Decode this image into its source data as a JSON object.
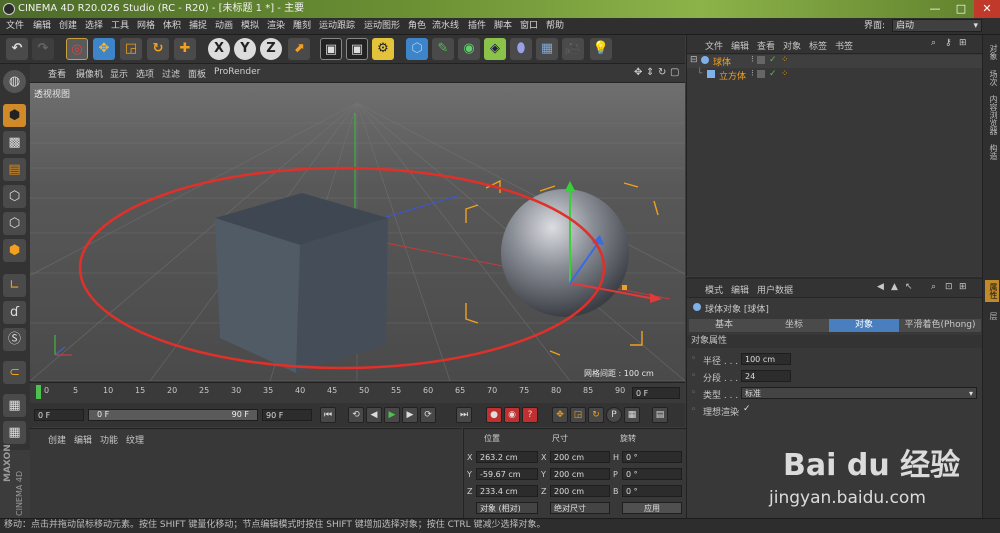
{
  "window": {
    "title": "CINEMA 4D R20.026 Studio (RC - R20) - [未标题 1 *] - 主要",
    "minimize": "—",
    "maximize": "□",
    "close": "✕"
  },
  "menu": {
    "items": [
      "文件",
      "编辑",
      "创建",
      "选择",
      "工具",
      "网格",
      "体积",
      "捕捉",
      "动画",
      "模拟",
      "渲染",
      "雕刻",
      "运动跟踪",
      "运动图形",
      "角色",
      "流水线",
      "插件",
      "脚本",
      "窗口",
      "帮助"
    ],
    "layout_label": "界面:",
    "layout_value": "启动"
  },
  "toolbar": {
    "axis_x": "X",
    "axis_y": "Y",
    "axis_z": "Z"
  },
  "viewport": {
    "menu": [
      "查看",
      "摄像机",
      "显示",
      "选项",
      "过滤",
      "面板",
      "ProRender"
    ],
    "view_name": "透视视图",
    "grid_spacing": "网格间距 : 100 cm"
  },
  "timeline": {
    "ticks": [
      "0",
      "5",
      "10",
      "15",
      "20",
      "25",
      "30",
      "35",
      "40",
      "45",
      "50",
      "55",
      "60",
      "65",
      "70",
      "75",
      "80",
      "85",
      "90"
    ],
    "current_frame_field": "0 F",
    "start_frame": "0 F",
    "range_start": "0 F",
    "range_end": "90 F",
    "end_frame": "90 F"
  },
  "material_manager": {
    "menu": [
      "创建",
      "编辑",
      "功能",
      "纹理"
    ]
  },
  "coordinates": {
    "headers": {
      "position": "位置",
      "size": "尺寸",
      "rotation": "旋转"
    },
    "rows": [
      {
        "axis": "X",
        "pos": "263.2 cm",
        "size_axis": "X",
        "size": "200 cm",
        "rot_axis": "H",
        "rot": "0 °"
      },
      {
        "axis": "Y",
        "pos": "-59.67 cm",
        "size_axis": "Y",
        "size": "200 cm",
        "rot_axis": "P",
        "rot": "0 °"
      },
      {
        "axis": "Z",
        "pos": "233.4 cm",
        "size_axis": "Z",
        "size": "200 cm",
        "rot_axis": "B",
        "rot": "0 °"
      }
    ],
    "mode_select": "对象 (相对)",
    "size_select": "绝对尺寸",
    "apply": "应用"
  },
  "object_manager": {
    "menu": [
      "文件",
      "编辑",
      "查看",
      "对象",
      "标签",
      "书签"
    ],
    "objects": [
      {
        "name": "球体"
      },
      {
        "name": "立方体"
      }
    ]
  },
  "attribute_manager": {
    "menu": [
      "模式",
      "编辑",
      "用户数据"
    ],
    "object_title": "球体对象 [球体]",
    "tabs": [
      "基本",
      "坐标",
      "对象",
      "平滑着色(Phong)"
    ],
    "active_tab": "对象",
    "section": "对象属性",
    "props": [
      {
        "label": "半径 . . . . .",
        "value": "100 cm"
      },
      {
        "label": "分段 . . . . .",
        "value": "24"
      },
      {
        "label": "类型 . . . . .",
        "value": "标准"
      },
      {
        "label": "理想渲染",
        "value": "✓"
      }
    ]
  },
  "right_tabs": [
    "对象",
    "场次",
    "内容浏览器",
    "构造",
    "属性",
    "层"
  ],
  "status": {
    "text": "移动：点击并拖动鼠标移动元素。按住 SHIFT 键量化移动；节点编辑模式时按住 SHIFT 键增加选择对象；按住 CTRL 键减少选择对象。"
  },
  "branding": {
    "maxon": "MAXON",
    "cinema": "CINEMA 4D"
  },
  "watermark": {
    "brand": "Bai du 经验",
    "url": "jingyan.baidu.com"
  },
  "colors": {
    "accent_blue": "#3d84c8",
    "tab_active": "#4a7fbf",
    "annotation_red": "#e0302a",
    "axis_x": "#e03a3a",
    "axis_y": "#3ac43a",
    "axis_z": "#3a6be0",
    "selection_orange": "#f0a020"
  }
}
